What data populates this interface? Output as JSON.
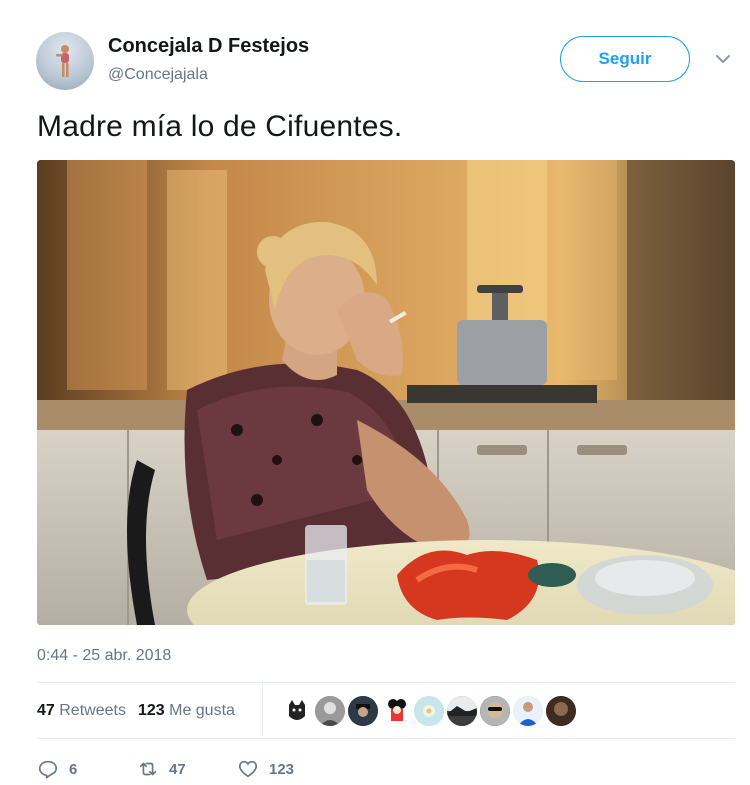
{
  "account": {
    "display_name": "Concejala D Festejos",
    "handle": "@Concejajala",
    "avatar_icon": "profile-avatar"
  },
  "follow_button": {
    "label": "Seguir"
  },
  "menu": {
    "icon": "chevron-down-icon"
  },
  "tweet": {
    "text": "Madre mía lo de Cifuentes.",
    "timestamp": "0:44 - 25 abr. 2018"
  },
  "stats": {
    "retweets_count": "47",
    "retweets_label": "Retweets",
    "likes_count": "123",
    "likes_label": "Me gusta"
  },
  "liker_avatars": [
    "cat",
    "bw-face",
    "dark-face",
    "cartoon",
    "flower",
    "landscape",
    "sunglasses",
    "blue-shirt",
    "portrait"
  ],
  "actions": {
    "reply_count": "6",
    "retweet_count": "47",
    "like_count": "123"
  },
  "colors": {
    "accent": "#1da1f2",
    "secondary_text": "#657786",
    "divider": "#e6ecf0"
  }
}
